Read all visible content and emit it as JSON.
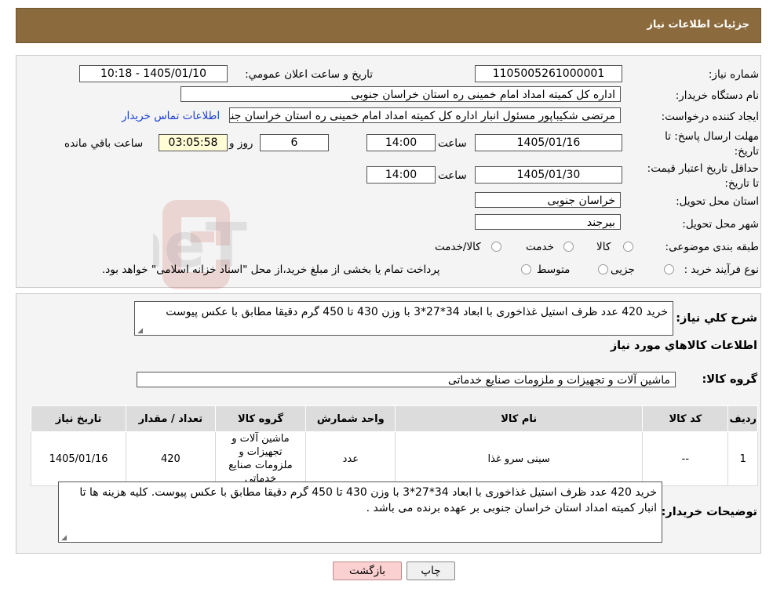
{
  "header": {
    "title": "جزئیات اطلاعات نیاز"
  },
  "fields": {
    "need_number": {
      "label": "شماره نیاز:",
      "value": "1105005261000001"
    },
    "announce_datetime": {
      "label": "تاریخ و ساعت اعلان عمومي:",
      "value": "1405/01/10 - 10:18"
    },
    "buyer_org": {
      "label": "نام دستگاه خریدار:",
      "value": "اداره کل کمیته امداد امام خمینی  ره  استان خراسان جنوبی"
    },
    "requester": {
      "label": "ایجاد کننده درخواست:",
      "value": "مرتضی شکیباپور مسئول انبار اداره کل کمیته امداد امام خمینی  ره  استان خراسان جنوبی"
    },
    "contact_link": "اطلاعات تماس خریدار",
    "deadline": {
      "label": "مهلت ارسال پاسخ: تا تاریخ:",
      "date": "1405/01/16",
      "time_label": "ساعت",
      "time": "14:00",
      "days": "6",
      "days_label": "روز و",
      "remaining": "03:05:58",
      "remaining_label": "ساعت باقي مانده"
    },
    "validity": {
      "label": "حداقل تاریخ اعتبار قیمت: تا تاریخ:",
      "date": "1405/01/30",
      "time_label": "ساعت",
      "time": "14:00"
    },
    "province": {
      "label": "استان محل تحویل:",
      "value": "خراسان جنوبی"
    },
    "city": {
      "label": "شهر محل تحویل:",
      "value": "بیرجند"
    },
    "category": {
      "label": "طبقه بندی موضوعی:",
      "options": [
        "کالا",
        "خدمت",
        "کالا/خدمت"
      ]
    },
    "process": {
      "label": "نوع فرآیند خرید :",
      "options": [
        "جزیی",
        "متوسط"
      ],
      "note": "پرداخت تمام یا بخشی از مبلغ خرید،از محل \"اسناد خزانه اسلامی\" خواهد بود."
    }
  },
  "summary": {
    "label": "شرح کلي نياز:",
    "value": "خرید 420 عدد ظرف استیل غذاخوری با ابعاد 34*27*3 با وزن 430 تا 450 گرم دقیقا مطابق با عکس پیوست"
  },
  "goods_section_title": "اطلاعات کالاهاي مورد نياز",
  "goods_group": {
    "label": "گروه کالا:",
    "value": "ماشین آلات و تجهیزات و ملزومات صنایع خدماتی"
  },
  "table": {
    "headers": [
      "ردیف",
      "کد کالا",
      "نام کالا",
      "واحد شمارش",
      "گروه کالا",
      "تعداد / مقدار",
      "تاریخ نیاز"
    ],
    "rows": [
      [
        "1",
        "--",
        "سینی سرو غذا",
        "عدد",
        "ماشین آلات و تجهیزات و ملزومات صنایع خدماتی",
        "420",
        "1405/01/16"
      ]
    ]
  },
  "buyer_notes": {
    "label": "توضیحات خریدار:",
    "value": "خرید 420 عدد ظرف استیل غذاخوری با ابعاد 34*27*3 با وزن 430 تا 450  گرم دقیقا مطابق با عکس پیوست. کلیه هزینه ها تا انبار کمیته امداد استان خراسان جنوبی بر عهده برنده می باشد ."
  },
  "buttons": {
    "print": "چاپ",
    "back": "بازگشت"
  },
  "watermark": "AriaTender.neT"
}
